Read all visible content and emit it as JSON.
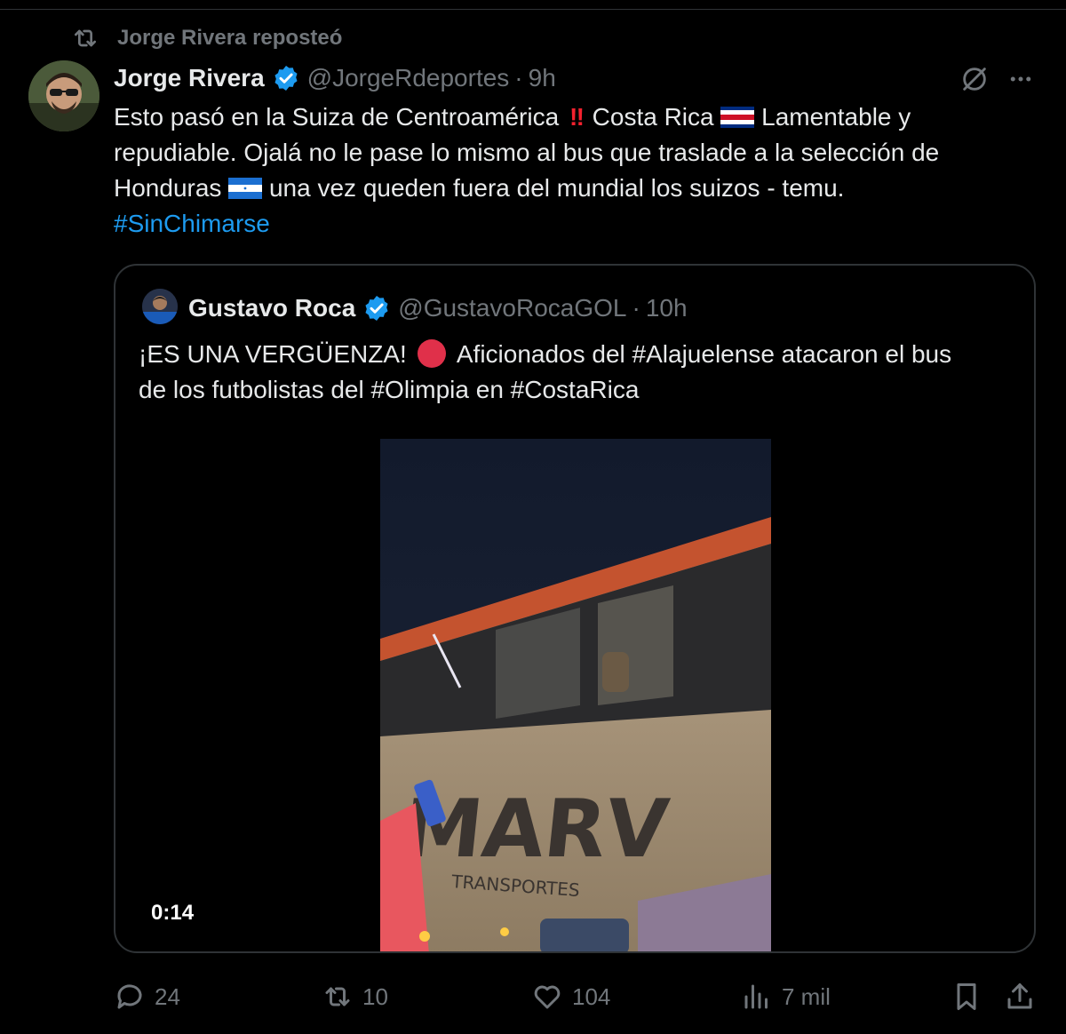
{
  "repost_banner": {
    "text": "Jorge Rivera reposteó"
  },
  "tweet": {
    "author_name": "Jorge Rivera",
    "handle": "@JorgeRdeportes",
    "separator": "·",
    "time": "9h",
    "text_part1": "Esto pasó en la Suiza de Centroamérica",
    "double_exclamation": "‼",
    "text_part2": "Costa Rica",
    "text_part3": "Lamentable y",
    "line2": "repudiable. Ojalá no le pase lo mismo al bus que traslade a la selección de",
    "line3a": "Honduras",
    "line3b": "una vez queden fuera del mundial los suizos - temu.",
    "hashtag": "#SinChimarse"
  },
  "quoted": {
    "author_name": "Gustavo Roca",
    "handle": "@GustavoRocaGOL",
    "separator": "·",
    "time": "10h",
    "line1a": "¡ES UNA VERGÜENZA!",
    "line1b": "Aficionados del #Alajuelense atacaron el bus",
    "line2": "de los futbolistas del #Olimpia en #CostaRica",
    "video_duration": "0:14",
    "video_text_brand": "MARV",
    "video_text_sub": "TRANSPORTES"
  },
  "actions": {
    "replies": "24",
    "reposts": "10",
    "likes": "104",
    "views": "7 mil"
  },
  "colors": {
    "background": "#000000",
    "text": "#e7e9ea",
    "muted": "#71767b",
    "accent": "#1d9bf0",
    "border": "#2f3336"
  },
  "icons": [
    "repost-icon",
    "verified-icon",
    "grok-icon",
    "more-icon",
    "reply-icon",
    "like-icon",
    "views-icon",
    "bookmark-icon",
    "share-icon"
  ]
}
